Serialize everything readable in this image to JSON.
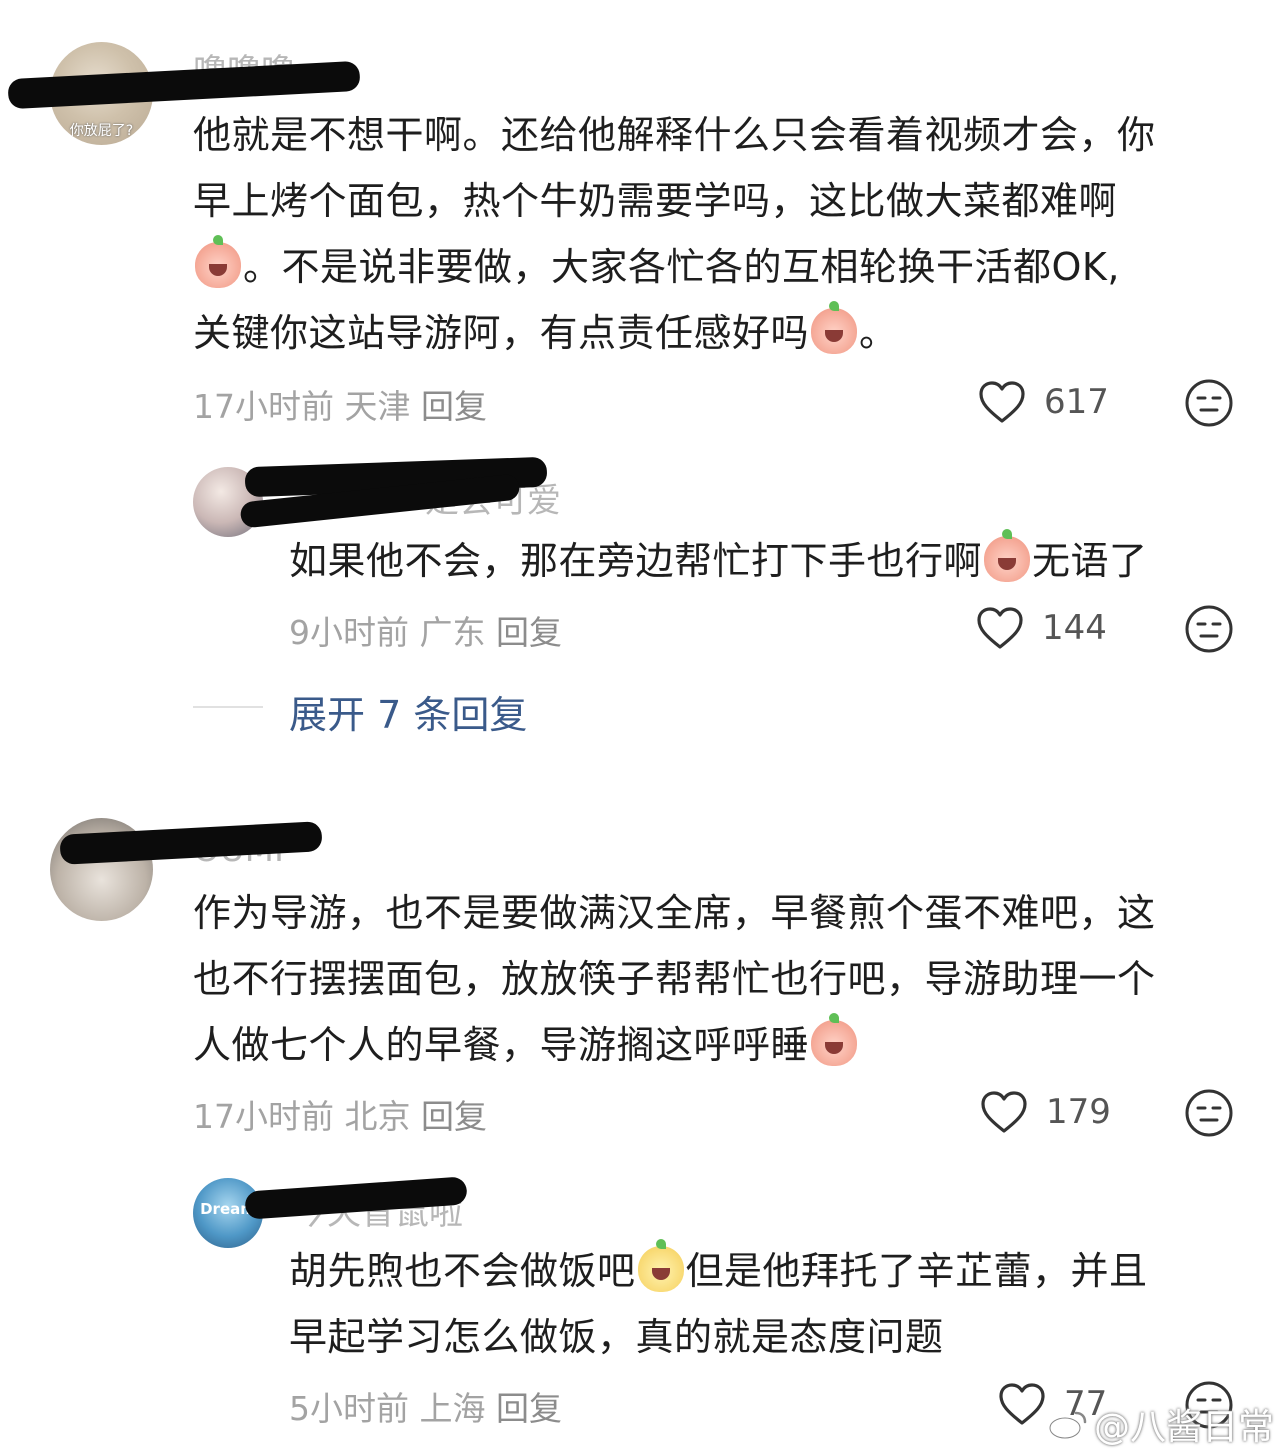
{
  "comments": [
    {
      "avatar_caption": "你放屁了?",
      "username": "噜噜噜",
      "lines": [
        "他就是不想干啊。还给他解释什么只会看着视频才会，你",
        "早上烤个面包，热个牛奶需要学吗，这比做大菜都难啊",
        "。不是说非要做，大家各忙各的互相轮换干活都OK,",
        "关键你这站导游阿，有点责任感好吗",
        "。"
      ],
      "time": "17小时前",
      "location": "天津",
      "reply_label": "回复",
      "likes": "617",
      "reply": {
        "username": "是会可爱",
        "lines": [
          "如果他不会，那在旁边帮忙打下手也行啊",
          "无语了"
        ],
        "time": "9小时前",
        "location": "广东",
        "reply_label": "回复",
        "likes": "144"
      },
      "expand_label": "展开 7 条回复"
    },
    {
      "username": "OUMI",
      "lines": [
        "作为导游，也不是要做满汉全席，早餐煎个蛋不难吧，这",
        "也不行摆摆面包，放放筷子帮帮忙也行吧，导游助理一个",
        "人做七个人的早餐，导游搁这呼呼睡"
      ],
      "time": "17小时前",
      "location": "北京",
      "reply_label": "回复",
      "likes": "179",
      "reply": {
        "avatar_caption": "Dream",
        "username": "今天冒鼠啦",
        "lines": [
          "胡先煦也不会做饭吧",
          "但是他拜托了辛芷蕾，并且",
          "早起学习怎么做饭，真的就是态度问题"
        ],
        "time": "5小时前",
        "location": "上海",
        "reply_label": "回复",
        "likes": "77"
      }
    }
  ],
  "watermark": "@八酱日常",
  "icons": {
    "like": "heart-outline-icon",
    "dislike": "neutral-face-icon",
    "emoji_cry": "crying-peach-emoji",
    "emoji_happy": "happy-peach-emoji",
    "watermark": "weibo-logo-icon"
  },
  "colors": {
    "text": "#1e1e1e",
    "meta": "#a3a3a3",
    "expand_link": "#3a5a8a",
    "background": "#ffffff"
  }
}
